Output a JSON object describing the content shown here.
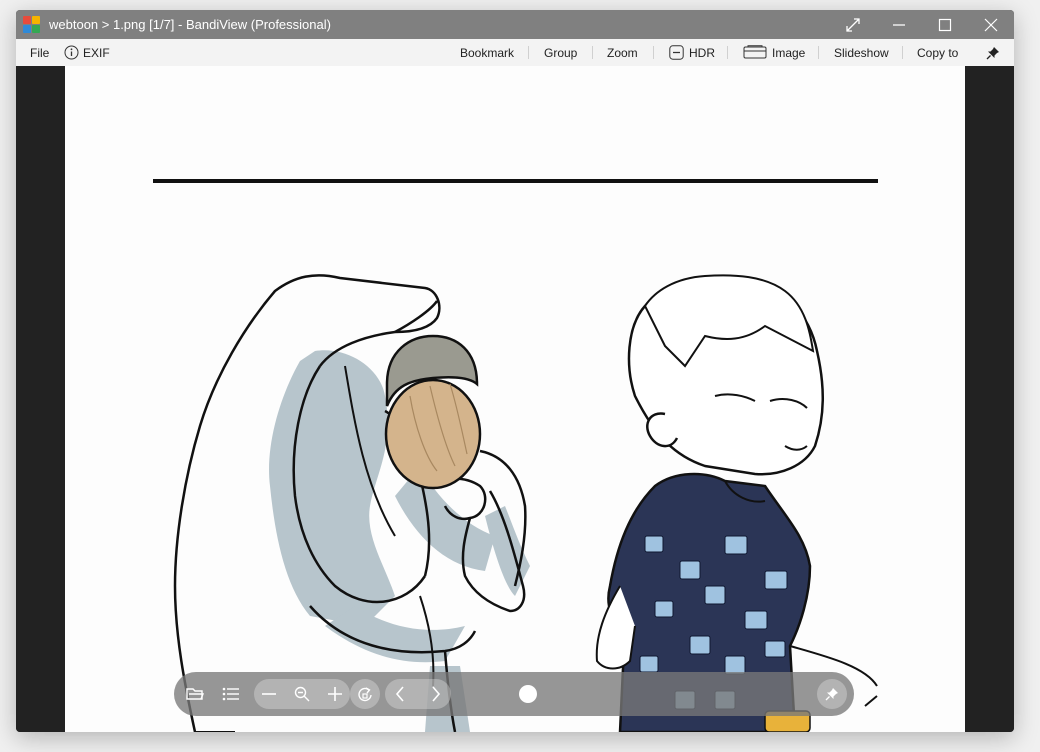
{
  "window": {
    "title": "webtoon > 1.png [1/7] - BandiView (Professional)"
  },
  "menu": {
    "file": "File",
    "exif": "EXIF",
    "bookmark": "Bookmark",
    "group": "Group",
    "zoom": "Zoom",
    "hdr": "HDR",
    "image": "Image",
    "slideshow": "Slideshow",
    "copy_to": "Copy to"
  },
  "icons": {
    "app": "bandiview-logo-icon",
    "exif": "info-icon",
    "hdr": "hdr-toggle-icon",
    "image": "image-icon",
    "pin": "pin-icon",
    "fullscreen": "expand-icon",
    "minimize": "minimize-icon",
    "maximize": "maximize-icon",
    "close": "close-icon"
  },
  "toolbar": {
    "buttons": [
      "folder-open-icon",
      "list-icon",
      "zoom-out-minus-icon",
      "zoom-fit-icon",
      "zoom-in-plus-icon",
      "rotate-icon",
      "previous-icon",
      "next-icon",
      "pin-icon"
    ],
    "page_position": 0.0
  },
  "colors": {
    "titlebar": "#808080",
    "menubar": "#f3f3f3",
    "viewer_bg": "#222222",
    "shirt": "#2b3556",
    "acorn_cap": "#9a9a90",
    "acorn_nut": "#d4b48c",
    "hand_shade": "#b7c5cc"
  }
}
